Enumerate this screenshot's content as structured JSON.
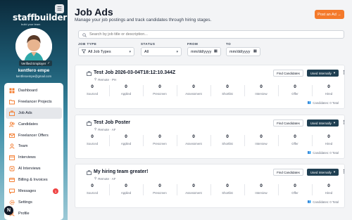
{
  "sidebar": {
    "logo": "staffbuilder",
    "logo_tagline": "build your team",
    "verified_label": "Verified Employer",
    "user_name": "kentfero empe",
    "user_email": "kentferoempe@gmail.com",
    "items": [
      {
        "label": "Dashboard",
        "icon": "dashboard-icon"
      },
      {
        "label": "Freelancer Projects",
        "icon": "folder-icon"
      },
      {
        "label": "Job Ads",
        "icon": "briefcase-icon",
        "active": true
      },
      {
        "label": "Candidates",
        "icon": "users-icon"
      },
      {
        "label": "Freelancer Offers",
        "icon": "mail-icon"
      },
      {
        "label": "Team",
        "icon": "team-icon"
      },
      {
        "label": "Interviews",
        "icon": "calendar-icon"
      },
      {
        "label": "AI Interviews",
        "icon": "ai-icon"
      },
      {
        "label": "Billing & Invoices",
        "icon": "billing-icon"
      },
      {
        "label": "Messages",
        "icon": "chat-icon",
        "badge": "1"
      },
      {
        "label": "Settings",
        "icon": "gear-icon"
      },
      {
        "label": "Profile",
        "icon": "profile-icon"
      }
    ],
    "fab_label": "N"
  },
  "header": {
    "title": "Job Ads",
    "subtitle": "Manage your job postings and track candidates through hiring stages.",
    "post_button": "Post an Ad"
  },
  "search": {
    "placeholder": "Search by job title or description..."
  },
  "filters": {
    "job_type_label": "JOB TYPE",
    "job_type_value": "All Job Types",
    "status_label": "STATUS",
    "status_value": "All",
    "from_label": "FROM",
    "from_placeholder": "mm/dd/yyyy",
    "to_label": "TO",
    "to_placeholder": "mm/dd/yyyy"
  },
  "job_cards": [
    {
      "title": "Test Job 2026-03-04T18:12:10.344Z",
      "location": "Remote · PH",
      "find_label": "Find Candidates",
      "status_label": "Used Internally",
      "stats": [
        {
          "value": "0",
          "label": "Sourced"
        },
        {
          "value": "0",
          "label": "Applied"
        },
        {
          "value": "0",
          "label": "Prescreen"
        },
        {
          "value": "0",
          "label": "Assessment"
        },
        {
          "value": "0",
          "label": "Shortlist"
        },
        {
          "value": "0",
          "label": "Interview"
        },
        {
          "value": "0",
          "label": "Offer"
        },
        {
          "value": "0",
          "label": "Hired"
        }
      ],
      "footer": "Candidates: 0 Total"
    },
    {
      "title": "Test Job Poster",
      "location": "Remote · AF",
      "find_label": "Find Candidates",
      "status_label": "Used Internally",
      "stats": [
        {
          "value": "0",
          "label": "Sourced"
        },
        {
          "value": "0",
          "label": "Applied"
        },
        {
          "value": "0",
          "label": "Prescreen"
        },
        {
          "value": "0",
          "label": "Assessment"
        },
        {
          "value": "0",
          "label": "Shortlist"
        },
        {
          "value": "0",
          "label": "Interview"
        },
        {
          "value": "0",
          "label": "Offer"
        },
        {
          "value": "0",
          "label": "Hired"
        }
      ],
      "footer": "Candidates: 0 Total"
    },
    {
      "title": "My hiring team greater!",
      "location": "Remote · AF",
      "find_label": "Find Candidates",
      "status_label": "Used Internally",
      "stats": [
        {
          "value": "0",
          "label": "Sourced"
        },
        {
          "value": "0",
          "label": "Applied"
        },
        {
          "value": "0",
          "label": "Prescreen"
        },
        {
          "value": "0",
          "label": "Assessment"
        },
        {
          "value": "0",
          "label": "Shortlist"
        },
        {
          "value": "0",
          "label": "Interview"
        },
        {
          "value": "0",
          "label": "Offer"
        },
        {
          "value": "0",
          "label": "Hired"
        }
      ],
      "footer": "Candidates: 0 Total"
    }
  ],
  "colors": {
    "accent": "#f47a2b",
    "status_button": "#1f3f52",
    "badge": "#ef4444"
  }
}
